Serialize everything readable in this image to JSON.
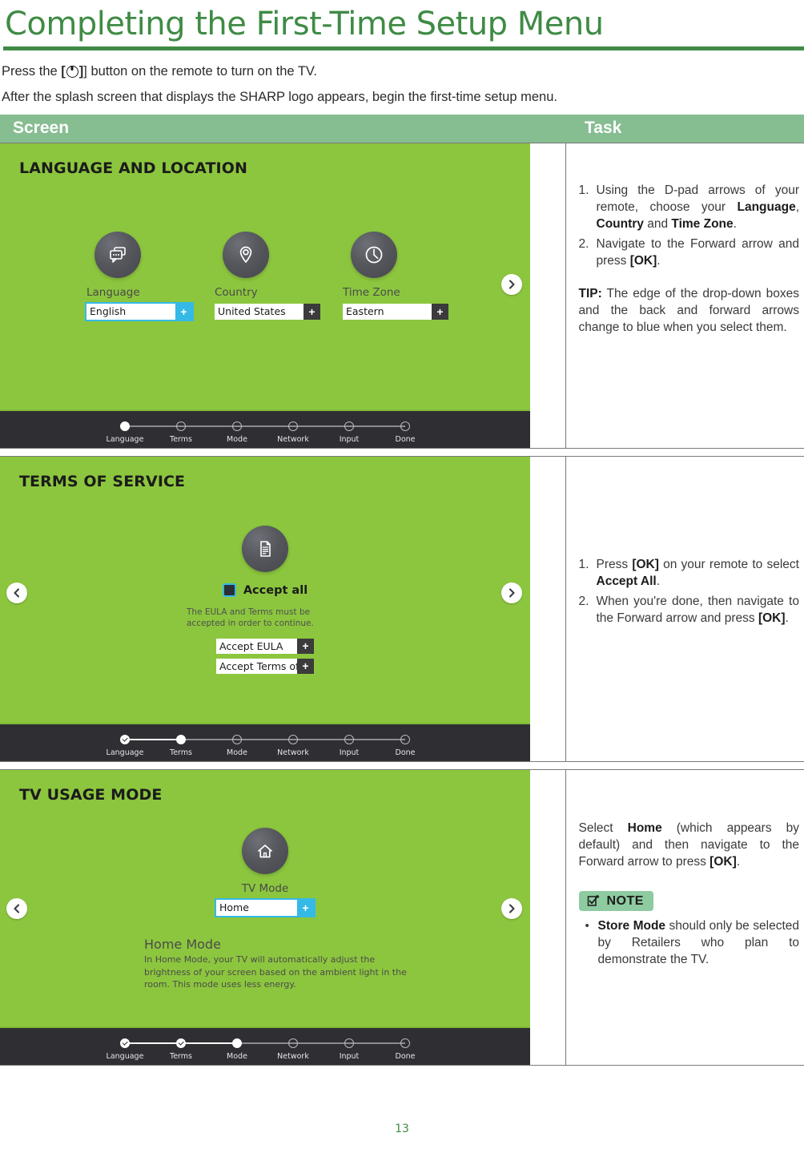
{
  "document": {
    "title": "Completing the First-Time Setup Menu",
    "page_number": "13"
  },
  "intro": {
    "line1_before": "Press the",
    "line1_bracket_open": "[",
    "line1_icon": "power-icon",
    "line1_bracket_close": "]",
    "line1_after": "] button on the remote to turn on the TV.",
    "line2": "After the splash screen that displays the SHARP logo appears, begin the first-time setup menu."
  },
  "table": {
    "headers": {
      "screen": "Screen",
      "task": "Task"
    }
  },
  "stepper": {
    "labels": [
      "Language",
      "Terms",
      "Mode",
      "Network",
      "Input",
      "Done"
    ]
  },
  "screens": {
    "row1": {
      "title": "LANGUAGE AND LOCATION",
      "fields": [
        {
          "icon": "chat-bubbles-icon",
          "label": "Language",
          "value": "English",
          "selected": true
        },
        {
          "icon": "location-pin-icon",
          "label": "Country",
          "value": "United States",
          "selected": false
        },
        {
          "icon": "clock-icon",
          "label": "Time Zone",
          "value": "Eastern",
          "selected": false
        }
      ],
      "plus_symbol": "+",
      "active_step": 0,
      "completed_steps": 0
    },
    "row2": {
      "title": "TERMS OF SERVICE",
      "icon": "document-icon",
      "accept_all_label": "Accept all",
      "eula_note": "The EULA and Terms must be accepted in order to continue.",
      "dropdowns": [
        {
          "value": "Accept EULA"
        },
        {
          "value": "Accept Terms of..."
        }
      ],
      "plus_symbol": "+",
      "active_step": 1,
      "completed_steps": 1
    },
    "row3": {
      "title": "TV USAGE MODE",
      "icon": "home-icon",
      "field_label": "TV Mode",
      "field_value": "Home",
      "plus_symbol": "+",
      "home_mode_title": "Home Mode",
      "home_mode_desc": "In Home Mode, your TV will automatically adjust the brightness of your screen based on the ambient light in the room. This mode uses less energy.",
      "active_step": 2,
      "completed_steps": 2
    }
  },
  "tasks": {
    "row1": {
      "steps": [
        {
          "num": "1.",
          "html": "Using the D-pad arrows of your remote, choose your <b>Language</b>, <b>Country</b> and <b>Time Zone</b>."
        },
        {
          "num": "2.",
          "html": "Navigate to the Forward arrow and press <b>[OK]</b>."
        }
      ],
      "tip_html": "<b>TIP:</b> The edge of the drop-down boxes and the back and forward arrows change to blue when you select them."
    },
    "row2": {
      "steps": [
        {
          "num": "1.",
          "html": "Press <b>[OK]</b> on your remote to select <b>Accept All</b>."
        },
        {
          "num": "2.",
          "html": "When you're done, then navigate to the Forward arrow and press <b>[OK]</b>."
        }
      ]
    },
    "row3": {
      "paragraph_html": "Select <b>Home</b> (which appears by default) and then navigate to the Forward arrow to press <b>[OK]</b>.",
      "note": {
        "label": "NOTE",
        "icon": "checkbox-pencil-icon",
        "items": [
          {
            "bullet": "•",
            "html": "<b>Store Mode</b> should only be selected by Retailers who plan to demonstrate the TV."
          }
        ]
      }
    }
  },
  "colors": {
    "title_green": "#3f8b45",
    "header_green": "#86bd91",
    "panel_green": "#8cc63e",
    "stepper_dark": "#2e2e33",
    "select_blue": "#35b9e6",
    "note_green": "#8ecba0"
  }
}
